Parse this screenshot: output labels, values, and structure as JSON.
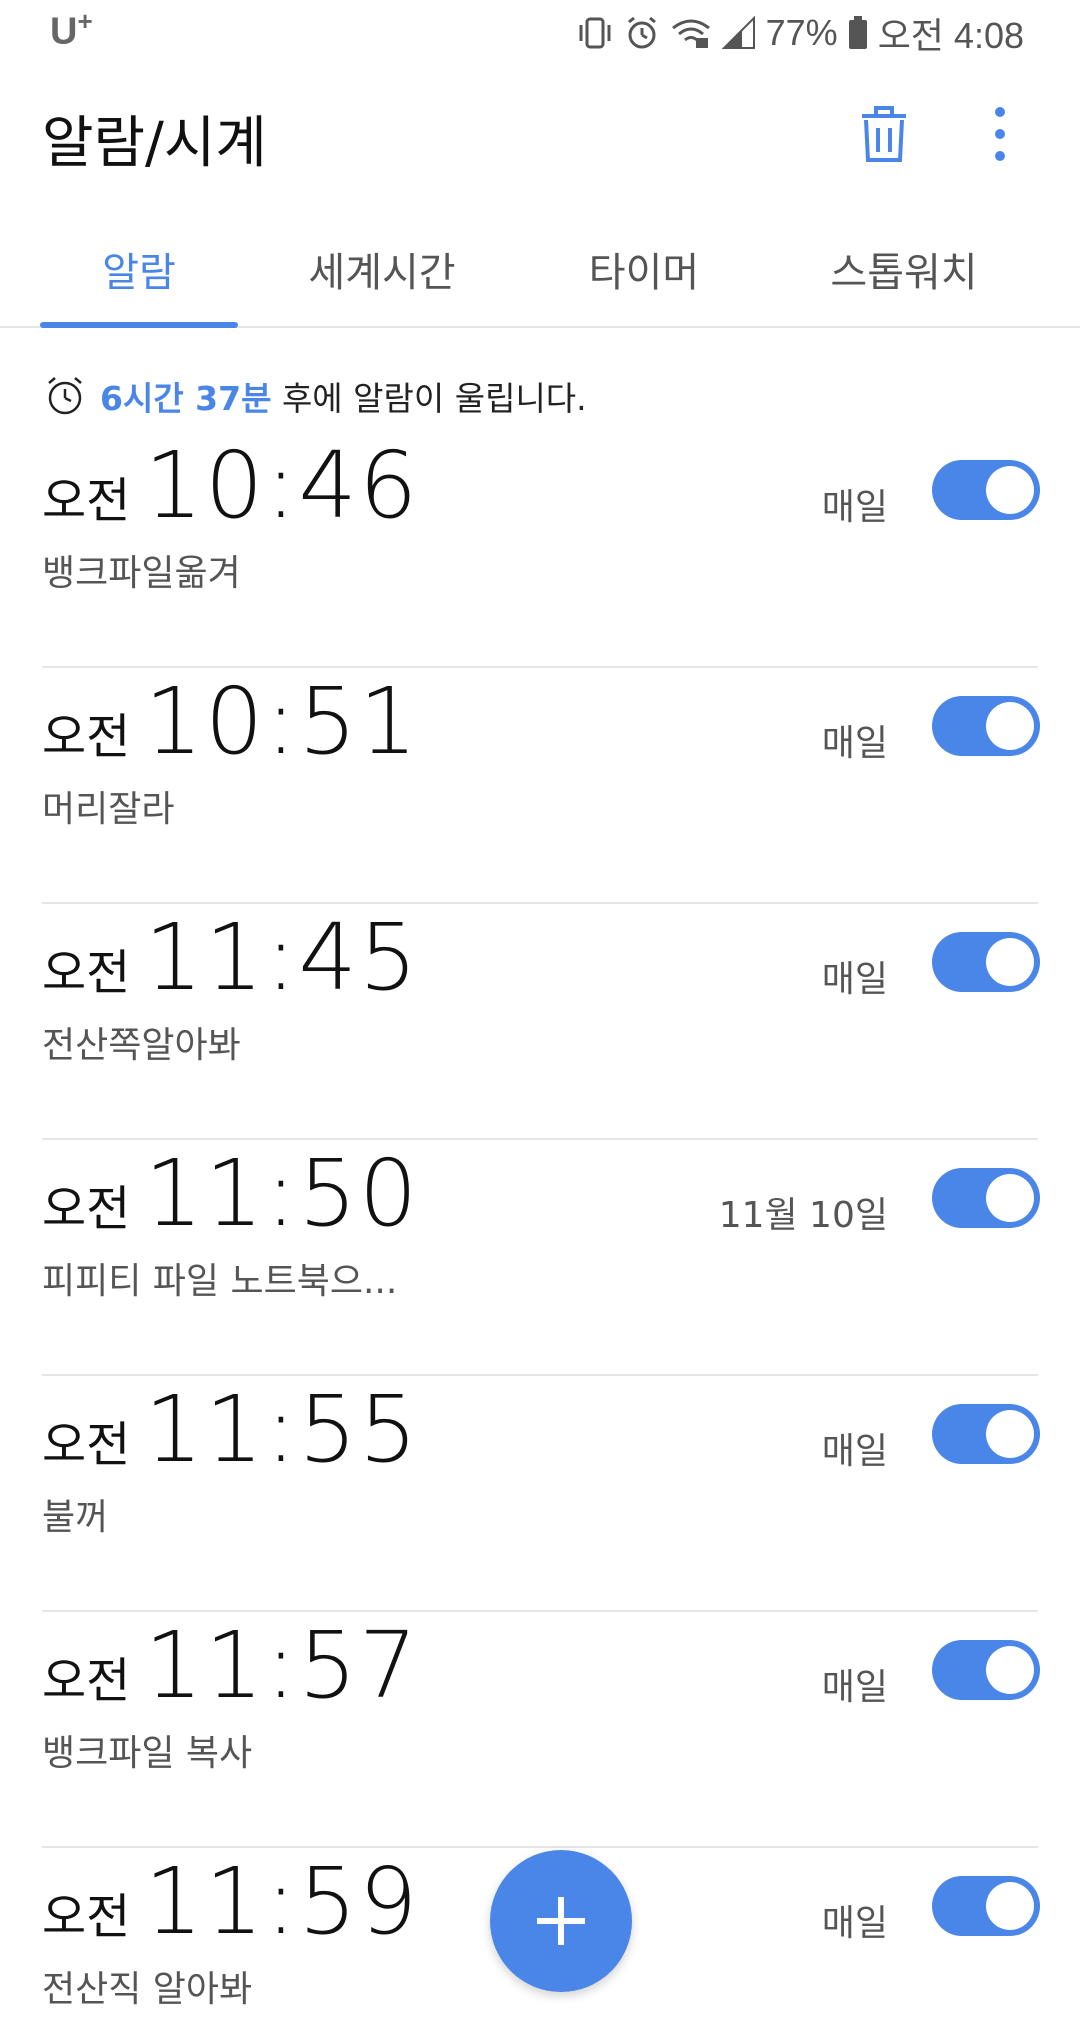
{
  "status_bar": {
    "carrier": "U",
    "carrier_sup": "+",
    "battery_percent": "77%",
    "time": "오전 4:08"
  },
  "header": {
    "title": "알람/시계"
  },
  "tabs": [
    {
      "label": "알람",
      "active": true
    },
    {
      "label": "세계시간",
      "active": false
    },
    {
      "label": "타이머",
      "active": false
    },
    {
      "label": "스톱워치",
      "active": false
    }
  ],
  "next_alarm": {
    "highlight": "6시간 37분",
    "rest": " 후에 알람이 울립니다."
  },
  "alarms": [
    {
      "ampm": "오전",
      "time": "10:46",
      "label": "뱅크파일옮겨",
      "repeat": "매일",
      "enabled": true
    },
    {
      "ampm": "오전",
      "time": "10:51",
      "label": "머리잘라",
      "repeat": "매일",
      "enabled": true
    },
    {
      "ampm": "오전",
      "time": "11:45",
      "label": "전산쪽알아봐",
      "repeat": "매일",
      "enabled": true
    },
    {
      "ampm": "오전",
      "time": "11:50",
      "label": "피피티 파일 노트북으...",
      "repeat": "11월 10일",
      "enabled": true
    },
    {
      "ampm": "오전",
      "time": "11:55",
      "label": "불꺼",
      "repeat": "매일",
      "enabled": true
    },
    {
      "ampm": "오전",
      "time": "11:57",
      "label": "뱅크파일 복사",
      "repeat": "매일",
      "enabled": true
    },
    {
      "ampm": "오전",
      "time": "11:59",
      "label": "전산직 알아봐",
      "repeat": "매일",
      "enabled": true
    }
  ],
  "colors": {
    "accent": "#4a86e8",
    "divider": "#e6e6e6"
  },
  "icons": {
    "trash": "trash-icon",
    "more": "more-vert-icon",
    "alarm": "alarm-clock-icon",
    "add": "plus-icon"
  }
}
